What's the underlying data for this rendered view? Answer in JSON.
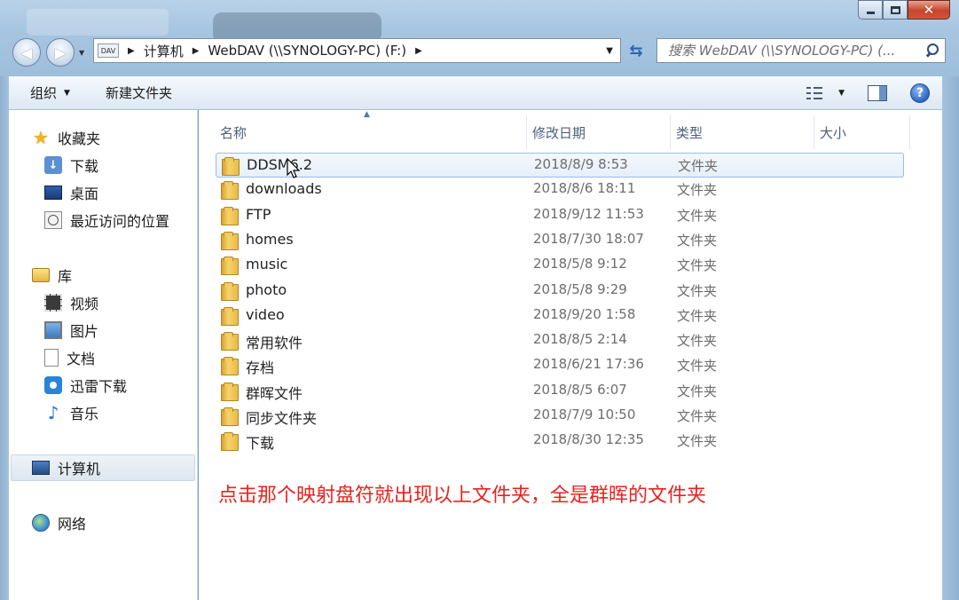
{
  "window": {
    "minimize_label": "minimize",
    "maximize_label": "maximize",
    "close_glyph": "✕"
  },
  "address": {
    "drive_icon_label": "DAV",
    "crumbs": [
      "计算机",
      "WebDAV (\\\\SYNOLOGY-PC) (F:)"
    ]
  },
  "search": {
    "placeholder": "搜索 WebDAV (\\\\SYNOLOGY-PC) (..."
  },
  "toolbar": {
    "organize": "组织",
    "new_folder": "新建文件夹"
  },
  "sidebar": {
    "favorites": {
      "label": "收藏夹",
      "items": [
        "下载",
        "桌面",
        "最近访问的位置"
      ]
    },
    "libraries": {
      "label": "库",
      "items": [
        "视频",
        "图片",
        "文档",
        "迅雷下载",
        "音乐"
      ]
    },
    "computer": "计算机",
    "network": "网络"
  },
  "columns": {
    "name": "名称",
    "modified": "修改日期",
    "type": "类型",
    "size": "大小"
  },
  "files": [
    {
      "name": "DDSM6.2",
      "date": "2018/8/9 8:53",
      "type": "文件夹",
      "selected": true
    },
    {
      "name": "downloads",
      "date": "2018/8/6 18:11",
      "type": "文件夹"
    },
    {
      "name": "FTP",
      "date": "2018/9/12 11:53",
      "type": "文件夹"
    },
    {
      "name": "homes",
      "date": "2018/7/30 18:07",
      "type": "文件夹"
    },
    {
      "name": "music",
      "date": "2018/5/8 9:12",
      "type": "文件夹"
    },
    {
      "name": "photo",
      "date": "2018/5/8 9:29",
      "type": "文件夹"
    },
    {
      "name": "video",
      "date": "2018/9/20 1:58",
      "type": "文件夹"
    },
    {
      "name": "常用软件",
      "date": "2018/8/5 2:14",
      "type": "文件夹"
    },
    {
      "name": "存档",
      "date": "2018/6/21 17:36",
      "type": "文件夹"
    },
    {
      "name": "群晖文件",
      "date": "2018/8/5 6:07",
      "type": "文件夹"
    },
    {
      "name": "同步文件夹",
      "date": "2018/7/9 10:50",
      "type": "文件夹"
    },
    {
      "name": "下载",
      "date": "2018/8/30 12:35",
      "type": "文件夹"
    }
  ],
  "caption": "点击那个映射盘符就出现以上文件夹，全是群晖的文件夹",
  "colors": {
    "caption": "#e8231e",
    "selection_border": "#99bde5",
    "chrome": "#a7c5e1"
  }
}
